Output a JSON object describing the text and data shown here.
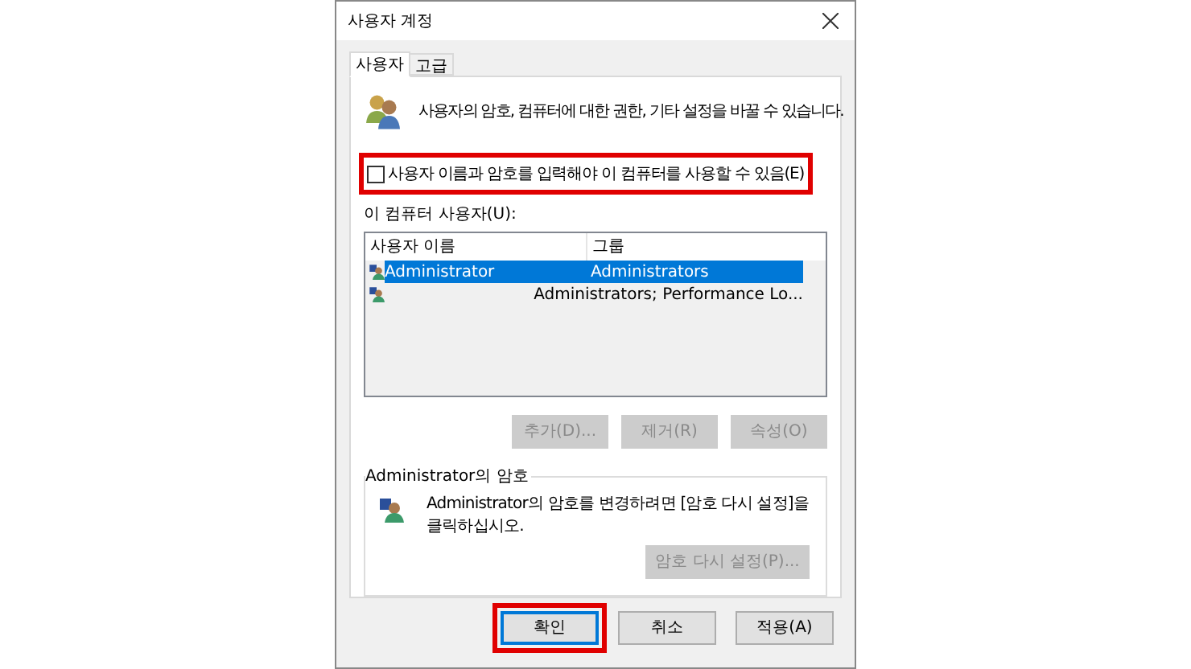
{
  "window": {
    "title": "사용자 계정"
  },
  "tabs": [
    {
      "label": "사용자",
      "selected": true
    },
    {
      "label": "고급",
      "selected": false
    }
  ],
  "description": "사용자의 암호, 컴퓨터에 대한 권한, 기타 설정을 바꿀 수 있습니다.",
  "require_login": {
    "label": "사용자 이름과 암호를 입력해야 이 컴퓨터를 사용할 수 있음(E)",
    "checked": false,
    "highlighted": true
  },
  "users_label": "이 컴퓨터 사용자(U):",
  "users_table": {
    "columns": [
      "사용자 이름",
      "그룹"
    ],
    "rows": [
      {
        "name": "Administrator",
        "group": "Administrators",
        "selected": true
      },
      {
        "group": "Administrators; Performance Lo...",
        "selected": false
      }
    ]
  },
  "user_buttons": [
    {
      "label": "추가(D)...",
      "disabled": true
    },
    {
      "label": "제거(R)",
      "disabled": true
    },
    {
      "label": "속성(O)",
      "disabled": true
    }
  ],
  "password_group": {
    "title": "Administrator의 암호",
    "text": "Administrator의 암호를 변경하려면 [암호 다시 설정]을 클릭하십시오.",
    "button": {
      "label": "암호 다시 설정(P)...",
      "disabled": true
    }
  },
  "dialog_buttons": [
    {
      "label": "확인",
      "default": true,
      "highlighted": true
    },
    {
      "label": "취소",
      "default": false,
      "highlighted": false
    },
    {
      "label": "적용(A)",
      "default": false,
      "highlighted": false
    }
  ]
}
